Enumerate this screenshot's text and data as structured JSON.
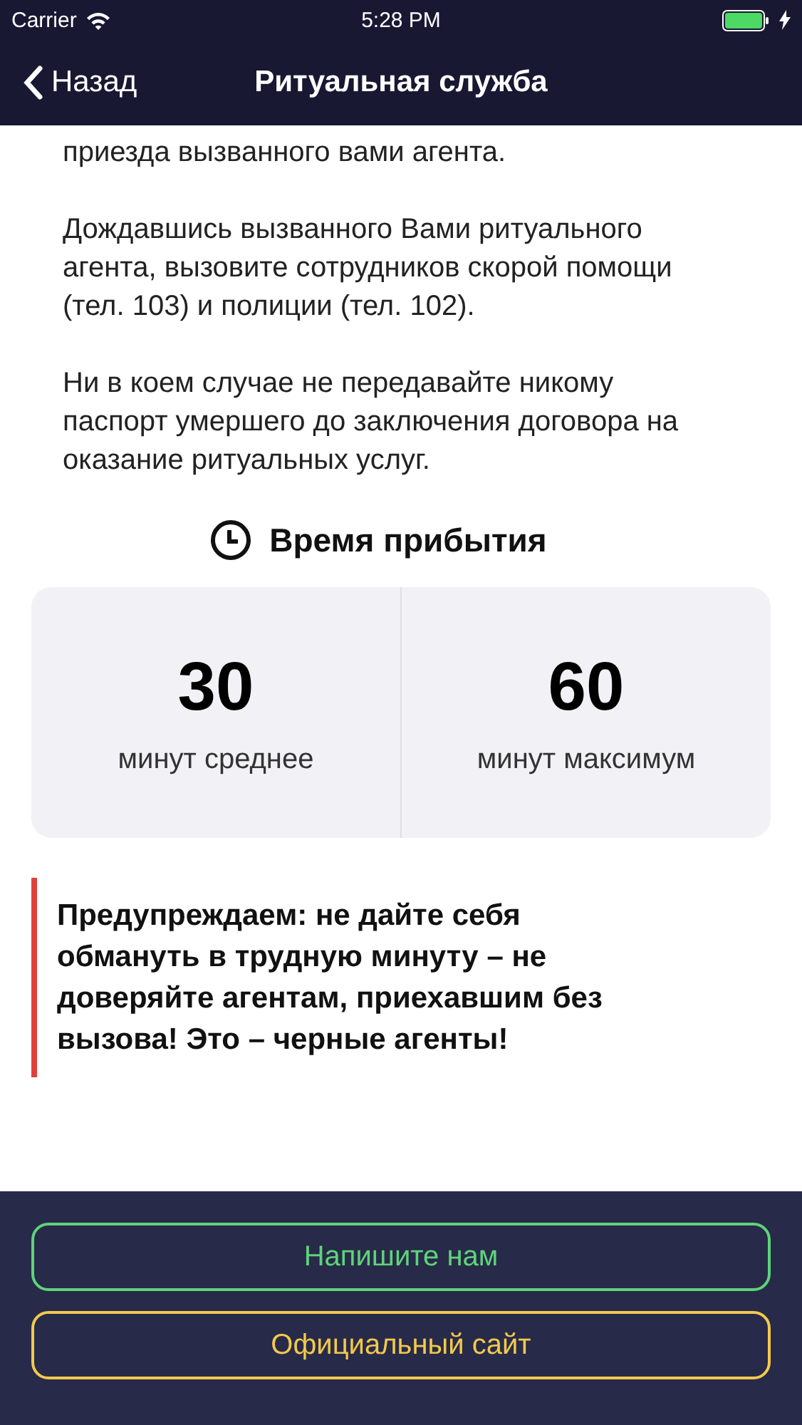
{
  "status_bar": {
    "carrier": "Carrier",
    "time": "5:28 PM"
  },
  "nav": {
    "back": "Назад",
    "title": "Ритуальная служба"
  },
  "paragraphs": [
    "приезда вызванного вами агента.",
    "Дождавшись вызванного Вами ритуального агента, вызовите сотрудников скорой помощи (тел. 103) и полиции (тел. 102).",
    "Ни в коем случае не передавайте никому паспорт умершего до заключения договора на оказание ритуальных услуг."
  ],
  "arrival": {
    "title": "Время прибытия",
    "stats": [
      {
        "value": "30",
        "label": "минут среднее"
      },
      {
        "value": "60",
        "label": "минут максимум"
      }
    ]
  },
  "warning": "Предупреждаем: не дайте себя обмануть в трудную минуту – не доверяйте агентам, приехавшим без вызова! Это – черные агенты!",
  "buttons": [
    {
      "label": "Напишите нам",
      "color": "#5fd37a"
    },
    {
      "label": "Официальный сайт",
      "color": "#f2c94c"
    }
  ]
}
